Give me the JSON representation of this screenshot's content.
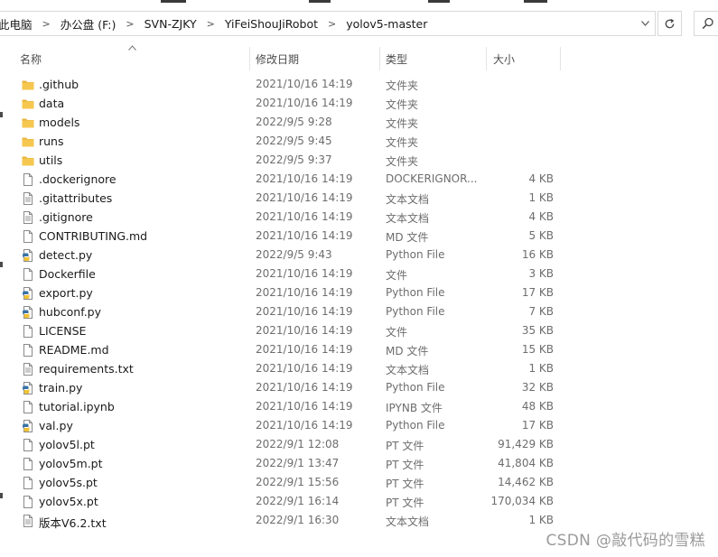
{
  "address": {
    "crumbs": [
      "此电脑",
      "办公盘 (F:)",
      "SVN-ZJKY",
      "YiFeiShouJiRobot",
      "yolov5-master"
    ]
  },
  "columns": {
    "name": "名称",
    "date": "修改日期",
    "type": "类型",
    "size": "大小"
  },
  "icons": {
    "folder": "folder-icon",
    "file": "file-icon",
    "text": "text-file-icon",
    "python": "python-file-icon",
    "refresh": "refresh-icon",
    "search": "search-icon",
    "dropdown": "chevron-down-icon"
  },
  "colors": {
    "folder": "#f6c74f",
    "python_blue": "#3772a4",
    "python_yellow": "#f2c232"
  },
  "files": [
    {
      "name": ".github",
      "date": "2021/10/16 14:19",
      "type": "文件夹",
      "size": "",
      "icon": "folder"
    },
    {
      "name": "data",
      "date": "2021/10/16 14:19",
      "type": "文件夹",
      "size": "",
      "icon": "folder"
    },
    {
      "name": "models",
      "date": "2022/9/5 9:28",
      "type": "文件夹",
      "size": "",
      "icon": "folder"
    },
    {
      "name": "runs",
      "date": "2022/9/5 9:45",
      "type": "文件夹",
      "size": "",
      "icon": "folder"
    },
    {
      "name": "utils",
      "date": "2022/9/5 9:37",
      "type": "文件夹",
      "size": "",
      "icon": "folder"
    },
    {
      "name": ".dockerignore",
      "date": "2021/10/16 14:19",
      "type": "DOCKERIGNOR...",
      "size": "4 KB",
      "icon": "file"
    },
    {
      "name": ".gitattributes",
      "date": "2021/10/16 14:19",
      "type": "文本文档",
      "size": "1 KB",
      "icon": "text"
    },
    {
      "name": ".gitignore",
      "date": "2021/10/16 14:19",
      "type": "文本文档",
      "size": "4 KB",
      "icon": "text"
    },
    {
      "name": "CONTRIBUTING.md",
      "date": "2021/10/16 14:19",
      "type": "MD 文件",
      "size": "5 KB",
      "icon": "file"
    },
    {
      "name": "detect.py",
      "date": "2022/9/5 9:43",
      "type": "Python File",
      "size": "16 KB",
      "icon": "python"
    },
    {
      "name": "Dockerfile",
      "date": "2021/10/16 14:19",
      "type": "文件",
      "size": "3 KB",
      "icon": "file"
    },
    {
      "name": "export.py",
      "date": "2021/10/16 14:19",
      "type": "Python File",
      "size": "17 KB",
      "icon": "python"
    },
    {
      "name": "hubconf.py",
      "date": "2021/10/16 14:19",
      "type": "Python File",
      "size": "7 KB",
      "icon": "python"
    },
    {
      "name": "LICENSE",
      "date": "2021/10/16 14:19",
      "type": "文件",
      "size": "35 KB",
      "icon": "file"
    },
    {
      "name": "README.md",
      "date": "2021/10/16 14:19",
      "type": "MD 文件",
      "size": "15 KB",
      "icon": "file"
    },
    {
      "name": "requirements.txt",
      "date": "2021/10/16 14:19",
      "type": "文本文档",
      "size": "1 KB",
      "icon": "text"
    },
    {
      "name": "train.py",
      "date": "2021/10/16 14:19",
      "type": "Python File",
      "size": "32 KB",
      "icon": "python"
    },
    {
      "name": "tutorial.ipynb",
      "date": "2021/10/16 14:19",
      "type": "IPYNB 文件",
      "size": "48 KB",
      "icon": "file"
    },
    {
      "name": "val.py",
      "date": "2021/10/16 14:19",
      "type": "Python File",
      "size": "17 KB",
      "icon": "python"
    },
    {
      "name": "yolov5l.pt",
      "date": "2022/9/1 12:08",
      "type": "PT 文件",
      "size": "91,429 KB",
      "icon": "file"
    },
    {
      "name": "yolov5m.pt",
      "date": "2022/9/1 13:47",
      "type": "PT 文件",
      "size": "41,804 KB",
      "icon": "file"
    },
    {
      "name": "yolov5s.pt",
      "date": "2022/9/1 15:56",
      "type": "PT 文件",
      "size": "14,462 KB",
      "icon": "file"
    },
    {
      "name": "yolov5x.pt",
      "date": "2022/9/1 16:14",
      "type": "PT 文件",
      "size": "170,034 KB",
      "icon": "file"
    },
    {
      "name": "版本V6.2.txt",
      "date": "2022/9/1 16:30",
      "type": "文本文档",
      "size": "1 KB",
      "icon": "text"
    }
  ],
  "watermark": "CSDN @敲代码的雪糕"
}
